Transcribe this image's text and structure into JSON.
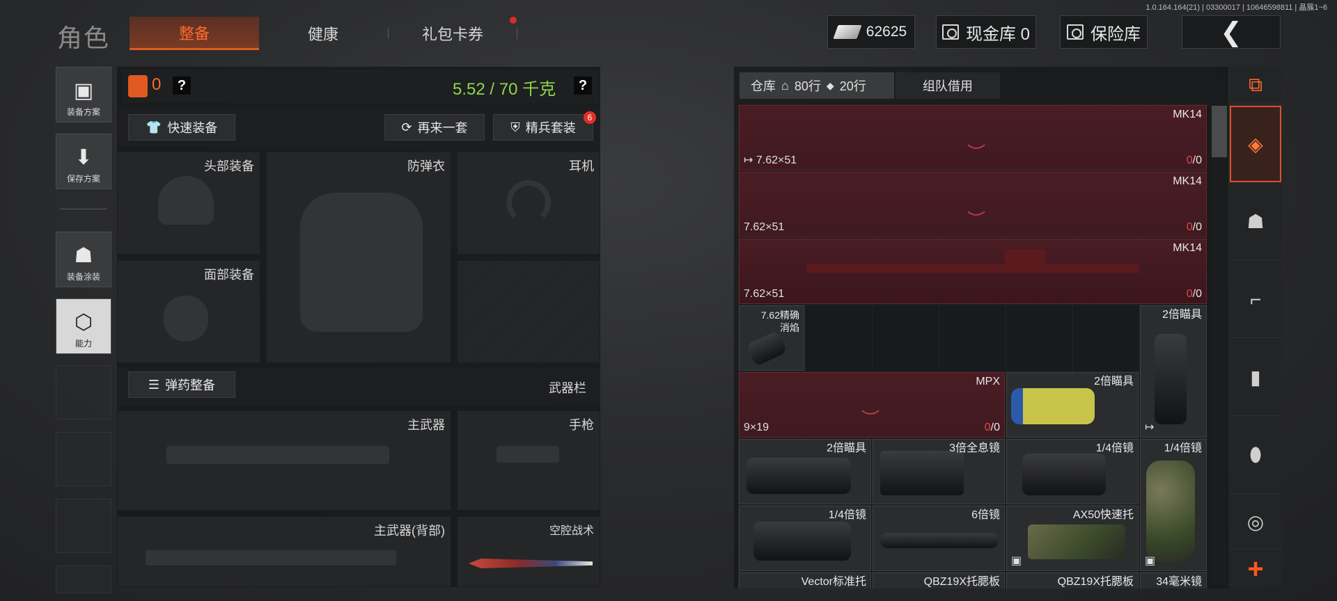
{
  "version": "1.0.164.164(21) | 03300017 | 10646598811 | 晶簇1~6",
  "header": {
    "title": "角色",
    "tabs": [
      {
        "label": "整备",
        "active": true
      },
      {
        "label": "健康",
        "active": false
      },
      {
        "label": "礼包卡券",
        "active": false,
        "has_dot": true
      }
    ],
    "money": "62625",
    "cash_vault": "现金库 0",
    "safe": "保险库",
    "back_glyph": "❮"
  },
  "left_sidebar": [
    {
      "label": "装备方案",
      "icon": "vest-icon"
    },
    {
      "label": "保存方案",
      "icon": "download-icon"
    },
    {
      "label": "装备涂装",
      "icon": "helmet-paint-icon"
    },
    {
      "label": "能力",
      "icon": "ability-icon",
      "active": true
    }
  ],
  "loadout": {
    "armor_count": "0",
    "help": "?",
    "weight": "5.52 / 70 千克",
    "quick_equip": "快速装备",
    "retry_set": "再来一套",
    "elite_set": "精兵套装",
    "elite_badge": "6",
    "slots": {
      "head": "头部装备",
      "armor": "防弹衣",
      "earphone": "耳机",
      "face": "面部装备"
    },
    "ammo_equip": "弹药整备",
    "weapon_bar": "武器栏",
    "weapons": {
      "primary": "主武器",
      "pistol": "手枪",
      "primary_back": "主武器(背部)",
      "melee": "空腔战术"
    }
  },
  "storage": {
    "tab_label": "仓库",
    "rows_home": "80行",
    "rows_ticket": "20行",
    "team_loan": "组队借用",
    "items": [
      {
        "name": "MK14",
        "caliber": "7.62×51",
        "ammo": "0/0"
      },
      {
        "name": "MK14",
        "caliber": "7.62×51",
        "ammo": "0/0"
      },
      {
        "name": "MK14",
        "caliber": "7.62×51",
        "ammo": "0/0"
      },
      {
        "name": "7.62精确\n消焰",
        "caliber": "",
        "ammo": ""
      },
      {
        "name": "2倍瞄具",
        "caliber": "",
        "ammo": ""
      },
      {
        "name": "MPX",
        "caliber": "9×19",
        "ammo": "0/0"
      },
      {
        "name": "2倍瞄具",
        "caliber": "",
        "ammo": ""
      },
      {
        "name": "2倍瞄具",
        "caliber": "",
        "ammo": ""
      },
      {
        "name": "3倍全息镜",
        "caliber": "",
        "ammo": ""
      },
      {
        "name": "1/4倍镜",
        "caliber": "",
        "ammo": ""
      },
      {
        "name": "1/4倍镜",
        "caliber": "",
        "ammo": ""
      },
      {
        "name": "1/4倍镜",
        "caliber": "",
        "ammo": ""
      },
      {
        "name": "6倍镜",
        "caliber": "",
        "ammo": ""
      },
      {
        "name": "AX50快速托",
        "caliber": "",
        "ammo": ""
      },
      {
        "name": "Vector标准托",
        "caliber": "",
        "ammo": ""
      },
      {
        "name": "QBZ19X托腮板",
        "caliber": "",
        "ammo": ""
      },
      {
        "name": "QBZ19X托腮板",
        "caliber": "",
        "ammo": ""
      },
      {
        "name": "34毫米镜",
        "caliber": "",
        "ammo": ""
      }
    ]
  },
  "rail": [
    "stack-refresh-icon",
    "backpack-icon",
    "helmet-icon",
    "rifle-icon",
    "magazine-icon",
    "bullet-icon",
    "red-dot-sight-icon",
    "plus-icon"
  ],
  "colors": {
    "accent": "#ff6a2c",
    "weight_green": "#8fd64a",
    "item_red_bg": "#4a1c24"
  }
}
